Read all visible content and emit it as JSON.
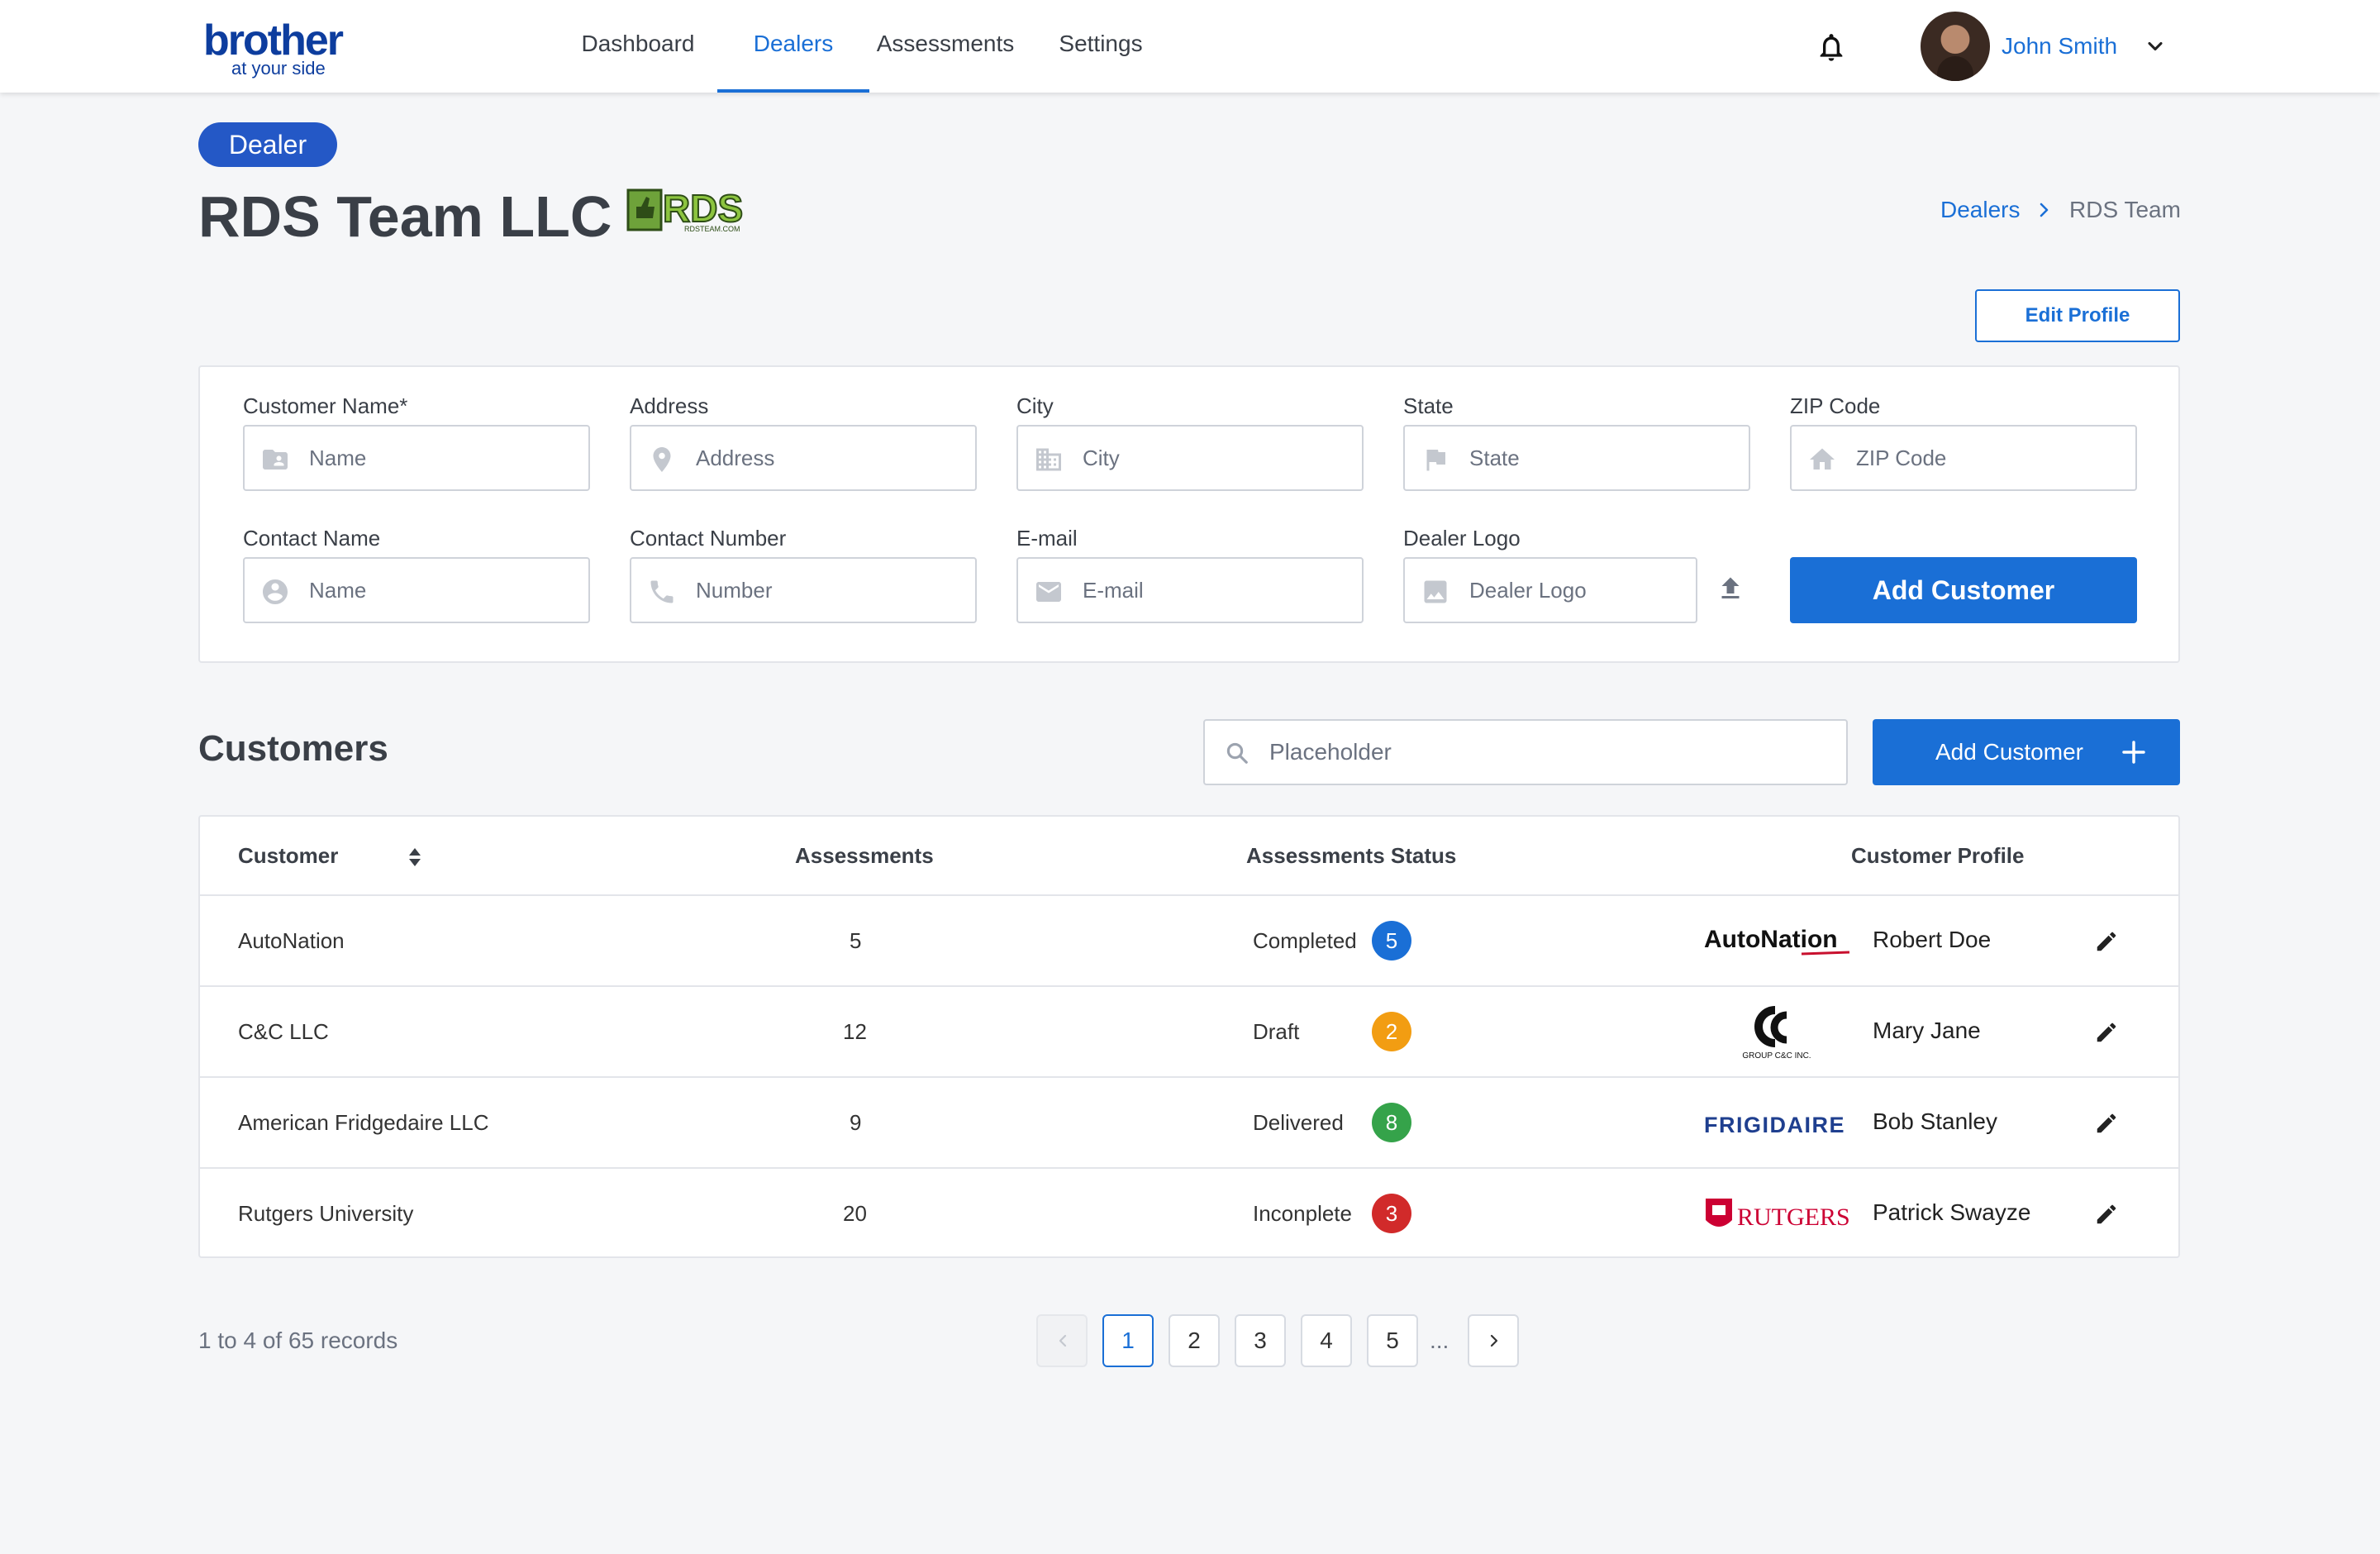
{
  "header": {
    "logo_brand": "brother",
    "logo_tagline": "at your side",
    "nav": [
      {
        "label": "Dashboard"
      },
      {
        "label": "Dealers"
      },
      {
        "label": "Assessments"
      },
      {
        "label": "Settings"
      }
    ],
    "active_nav": "Dealers",
    "user_name": "John Smith"
  },
  "dealer": {
    "badge": "Dealer",
    "name": "RDS Team LLC",
    "logo_text": "RDS",
    "logo_subtext": "RDSTEAM.COM"
  },
  "breadcrumb": {
    "parent": "Dealers",
    "current": "RDS Team"
  },
  "edit_profile_label": "Edit Profile",
  "form": {
    "fields": [
      {
        "label": "Customer Name*",
        "placeholder": "Name",
        "icon": "contact-card-icon"
      },
      {
        "label": "Address",
        "placeholder": "Address",
        "icon": "location-pin-icon"
      },
      {
        "label": "City",
        "placeholder": "City",
        "icon": "building-icon"
      },
      {
        "label": "State",
        "placeholder": "State",
        "icon": "flag-icon"
      },
      {
        "label": "ZIP Code",
        "placeholder": "ZIP Code",
        "icon": "home-icon"
      },
      {
        "label": "Contact Name",
        "placeholder": "Name",
        "icon": "person-icon"
      },
      {
        "label": "Contact Number",
        "placeholder": "Number",
        "icon": "phone-icon"
      },
      {
        "label": "E-mail",
        "placeholder": "E-mail",
        "icon": "mail-icon"
      },
      {
        "label": "Dealer Logo",
        "placeholder": "Dealer Logo",
        "icon": "image-icon"
      }
    ],
    "submit_label": "Add Customer"
  },
  "customers": {
    "title": "Customers",
    "search_placeholder": "Placeholder",
    "add_button_label": "Add Customer",
    "columns": [
      "Customer",
      "Assessments",
      "Assessments Status",
      "Customer Profile"
    ],
    "rows": [
      {
        "customer": "AutoNation",
        "assessments": "5",
        "status": "Completed",
        "status_count": "5",
        "status_color": "#1a6fd6",
        "logo": "AutoNation",
        "profile": "Robert Doe"
      },
      {
        "customer": "C&C LLC",
        "assessments": "12",
        "status": "Draft",
        "status_count": "2",
        "status_color": "#f29d12",
        "logo": "GROUP C&C INC.",
        "profile": "Mary Jane"
      },
      {
        "customer": "American Fridgedaire LLC",
        "assessments": "9",
        "status": "Delivered",
        "status_count": "8",
        "status_color": "#35a34a",
        "logo": "FRIGIDAIRE",
        "profile": "Bob Stanley"
      },
      {
        "customer": "Rutgers University",
        "assessments": "20",
        "status": "Inconplete",
        "status_count": "3",
        "status_color": "#d12a2a",
        "logo": "RUTGERS",
        "profile": "Patrick Swayze"
      }
    ]
  },
  "pagination": {
    "summary": "1 to 4 of 65 records",
    "pages": [
      "1",
      "2",
      "3",
      "4",
      "5"
    ],
    "current": "1",
    "ellipsis": "..."
  },
  "colors": {
    "primary": "#1a6fd6",
    "badge": "#2458c6",
    "brand": "#0d3d9e"
  }
}
